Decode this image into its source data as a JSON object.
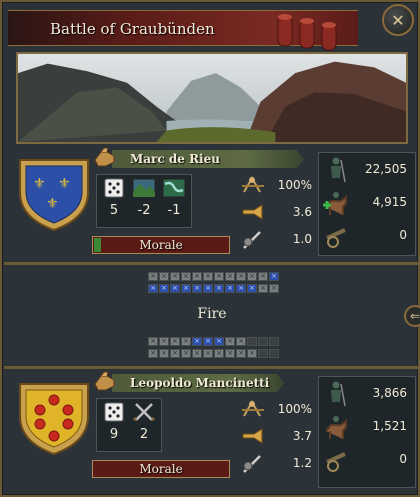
{
  "window": {
    "title": "Battle of Graubünden"
  },
  "phase": "Fire",
  "attacker": {
    "commander": "Marc de Rieu",
    "stats": [
      {
        "icon": "dice-icon",
        "value": "5"
      },
      {
        "icon": "terrain-icon",
        "value": "-2"
      },
      {
        "icon": "river-crossing-icon",
        "value": "-1"
      }
    ],
    "morale": {
      "label": "Morale",
      "fraction": 0.05
    },
    "modifiers": [
      {
        "icon": "discipline-icon",
        "value": "100%"
      },
      {
        "icon": "fire-bugle-icon",
        "value": "3.6"
      },
      {
        "icon": "shock-icon",
        "value": "1.0"
      }
    ],
    "troops": [
      {
        "icon": "infantry-icon",
        "value": "22,505"
      },
      {
        "icon": "cavalry-icon",
        "value": "4,915"
      },
      {
        "icon": "artillery-icon",
        "value": "0"
      }
    ]
  },
  "defender": {
    "commander": "Leopoldo Mancinetti",
    "stats": [
      {
        "icon": "dice-icon",
        "value": "9"
      },
      {
        "icon": "crossed-swords-icon",
        "value": "2"
      }
    ],
    "morale": {
      "label": "Morale",
      "fraction": 0.0
    },
    "modifiers": [
      {
        "icon": "discipline-icon",
        "value": "100%"
      },
      {
        "icon": "fire-bugle-icon",
        "value": "3.7"
      },
      {
        "icon": "shock-icon",
        "value": "1.2"
      }
    ],
    "troops": [
      {
        "icon": "infantry-icon",
        "value": "3,866"
      },
      {
        "icon": "cavalry-icon",
        "value": "1,521"
      },
      {
        "icon": "artillery-icon",
        "value": "0"
      }
    ]
  },
  "colors": {
    "attacker_shield": "#2c4fa8",
    "defender_shield": "#e0b428",
    "morale_fill": "#3c8a35",
    "frontline_blue": "#2b4fb0"
  }
}
